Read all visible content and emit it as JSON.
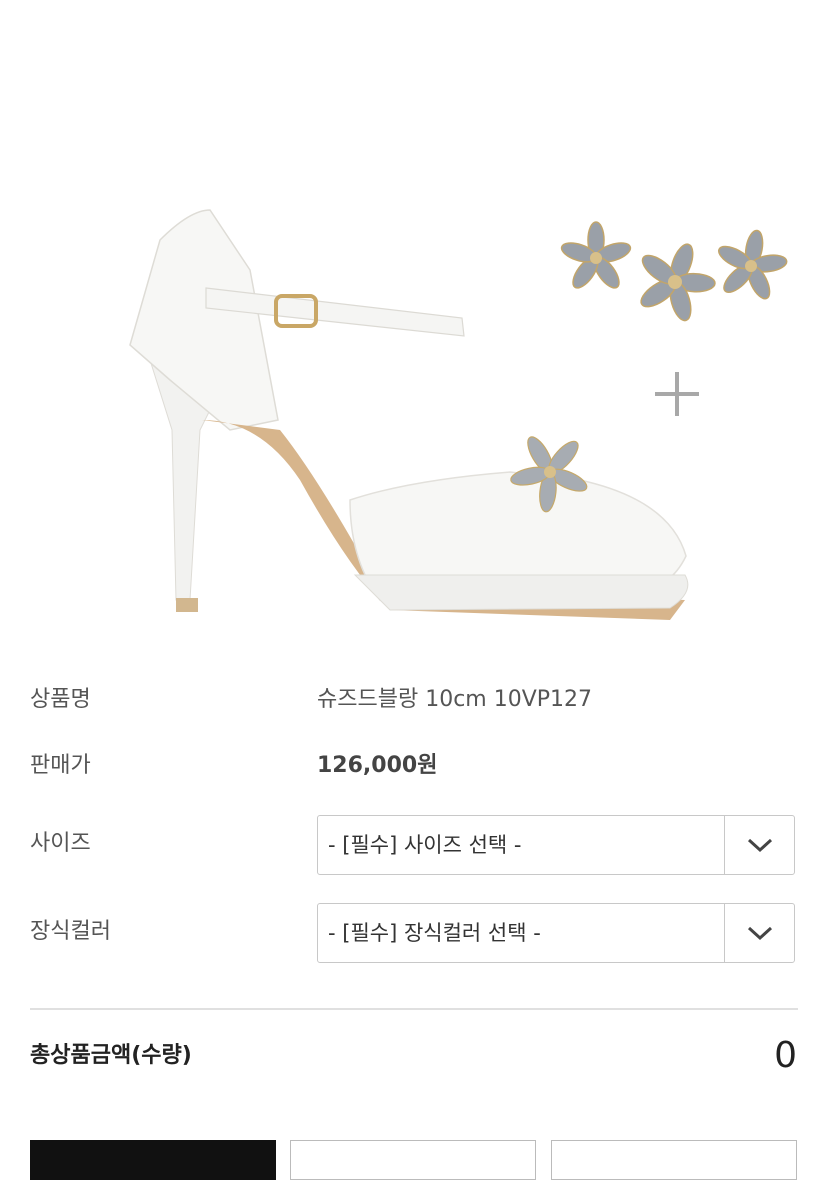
{
  "product": {
    "name_label": "상품명",
    "name_value": "슈즈드블랑 10cm 10VP127",
    "price_label": "판매가",
    "price_value": "126,000원"
  },
  "options": {
    "size_label": "사이즈",
    "size_selected": "- [필수] 사이즈 선택 -",
    "decor_label": "장식컬러",
    "decor_selected": "- [필수] 장식컬러 선택 -"
  },
  "total": {
    "label": "총상품금액(수량)",
    "value": "0"
  },
  "icons": {
    "dropdown": "chevron-down-icon",
    "plus": "plus-icon"
  }
}
